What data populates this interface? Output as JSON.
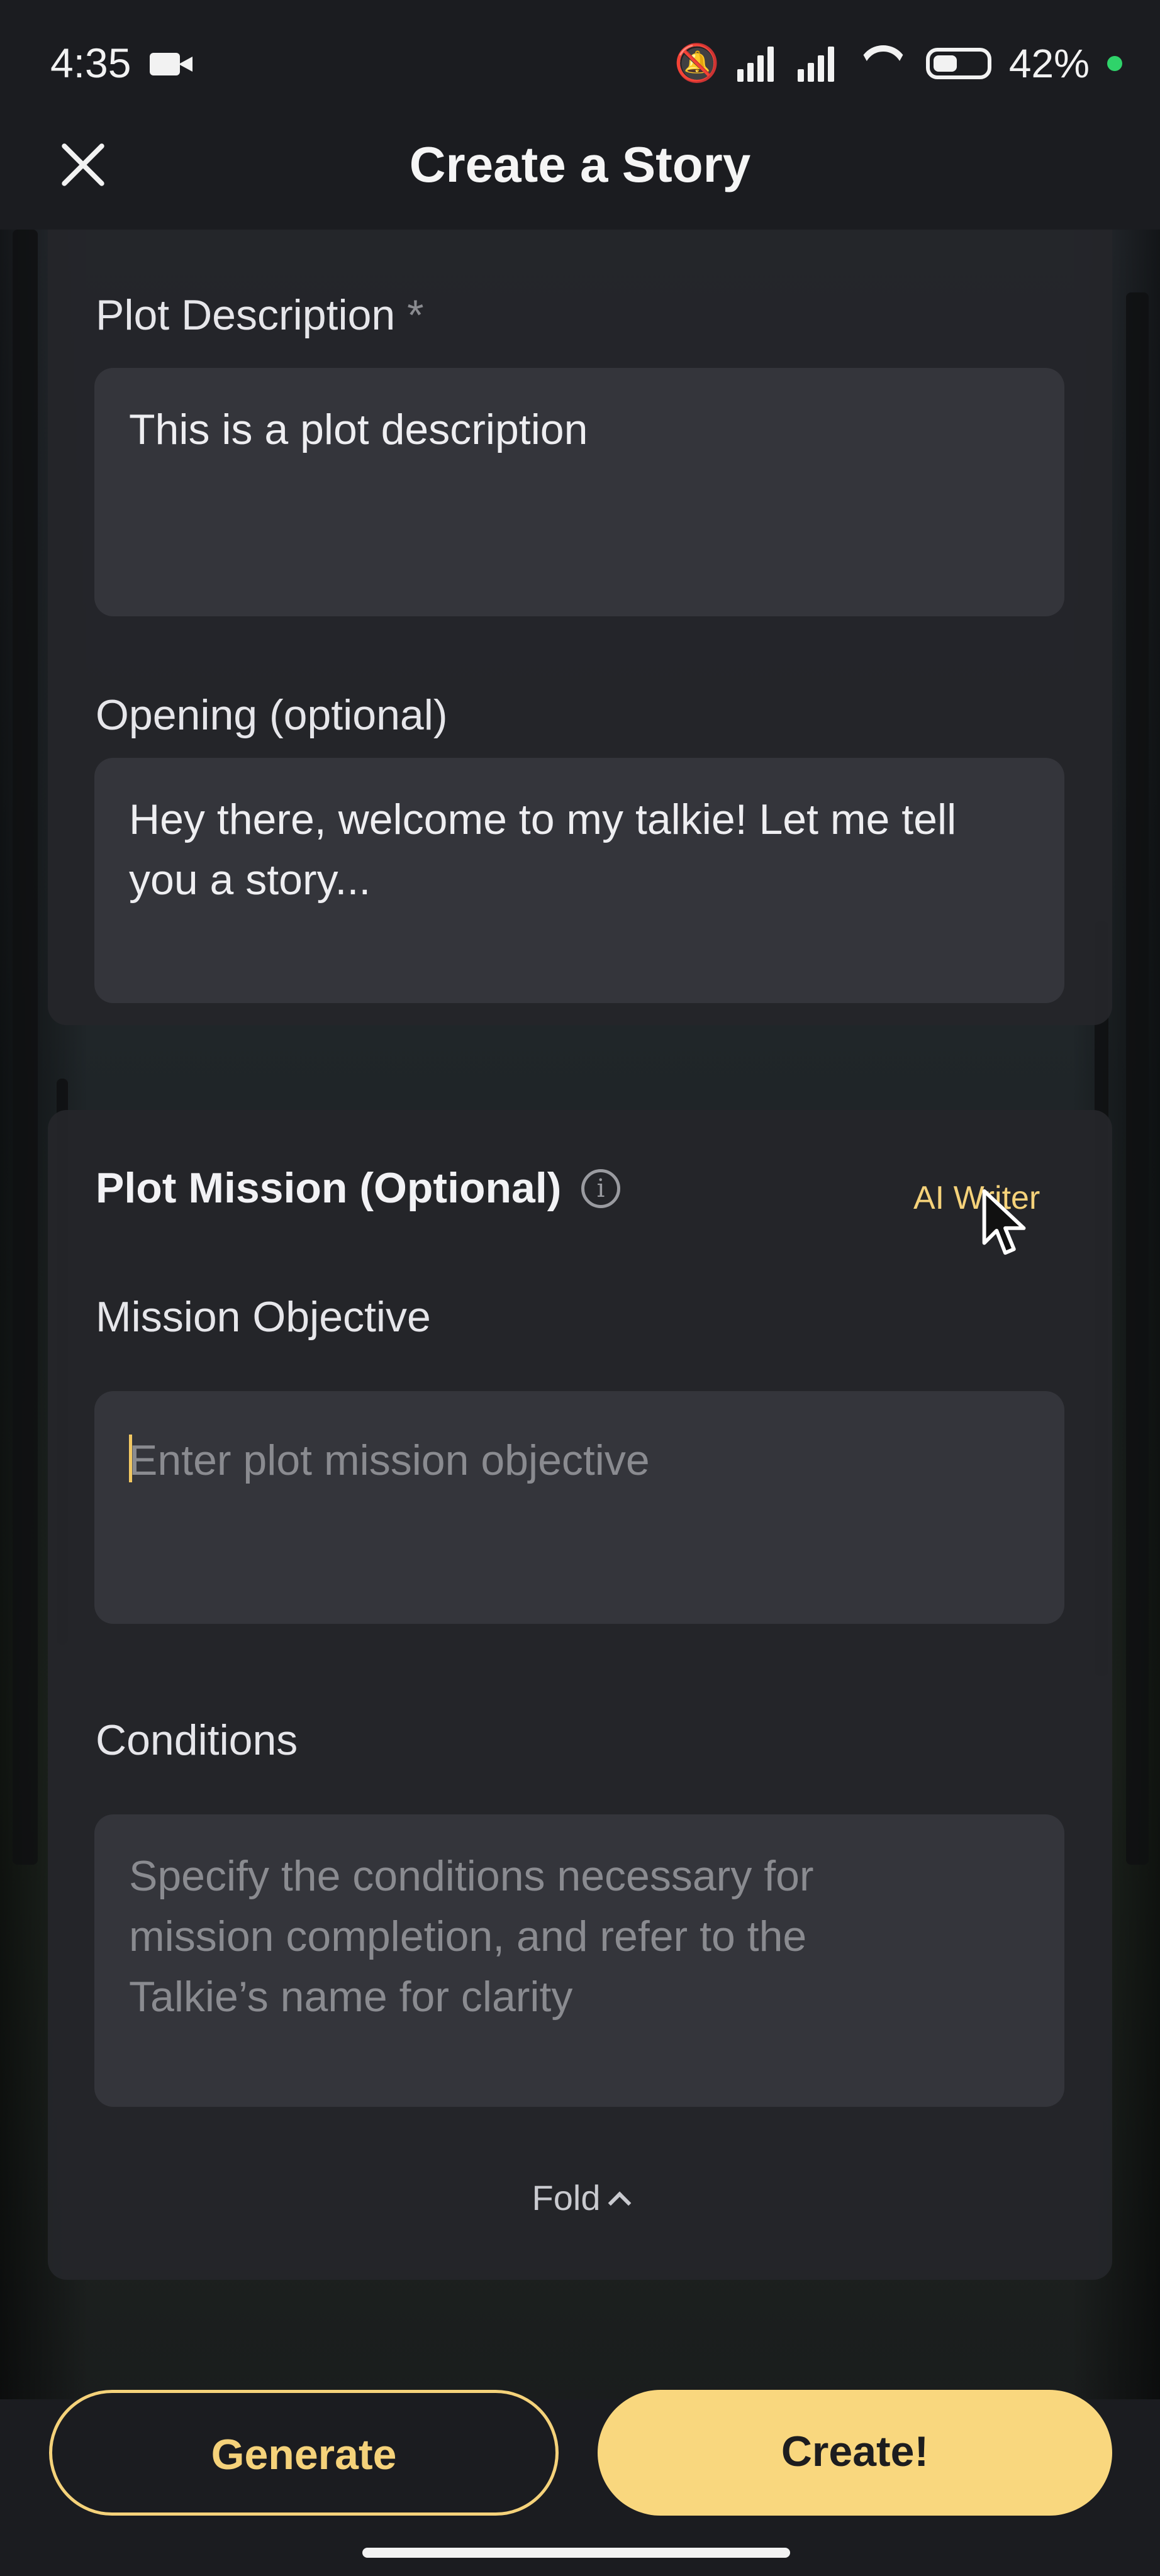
{
  "status_bar": {
    "time": "4:35",
    "battery": "42%"
  },
  "header": {
    "title": "Create a Story"
  },
  "story_section": {
    "plot_description": {
      "label": "Plot Description",
      "required_marker": "*",
      "value": "This is a plot description"
    },
    "opening": {
      "label": "Opening (optional)",
      "value": "Hey there, welcome to my talkie! Let me tell you a story..."
    }
  },
  "mission_section": {
    "title": "Plot Mission (Optional)",
    "ai_writer_label": "AI Writer",
    "mission_objective": {
      "label": "Mission Objective",
      "placeholder": "Enter plot mission objective"
    },
    "conditions": {
      "label": "Conditions",
      "placeholder": "Specify the conditions necessary for mission completion, and refer to the Talkie’s name for clarity"
    },
    "fold_label": "Fold"
  },
  "buttons": {
    "generate": "Generate",
    "create": "Create!"
  },
  "colors": {
    "accent": "#f9d77e",
    "background": "#1b1c20",
    "card": "#24252a",
    "field": "#34353b"
  }
}
